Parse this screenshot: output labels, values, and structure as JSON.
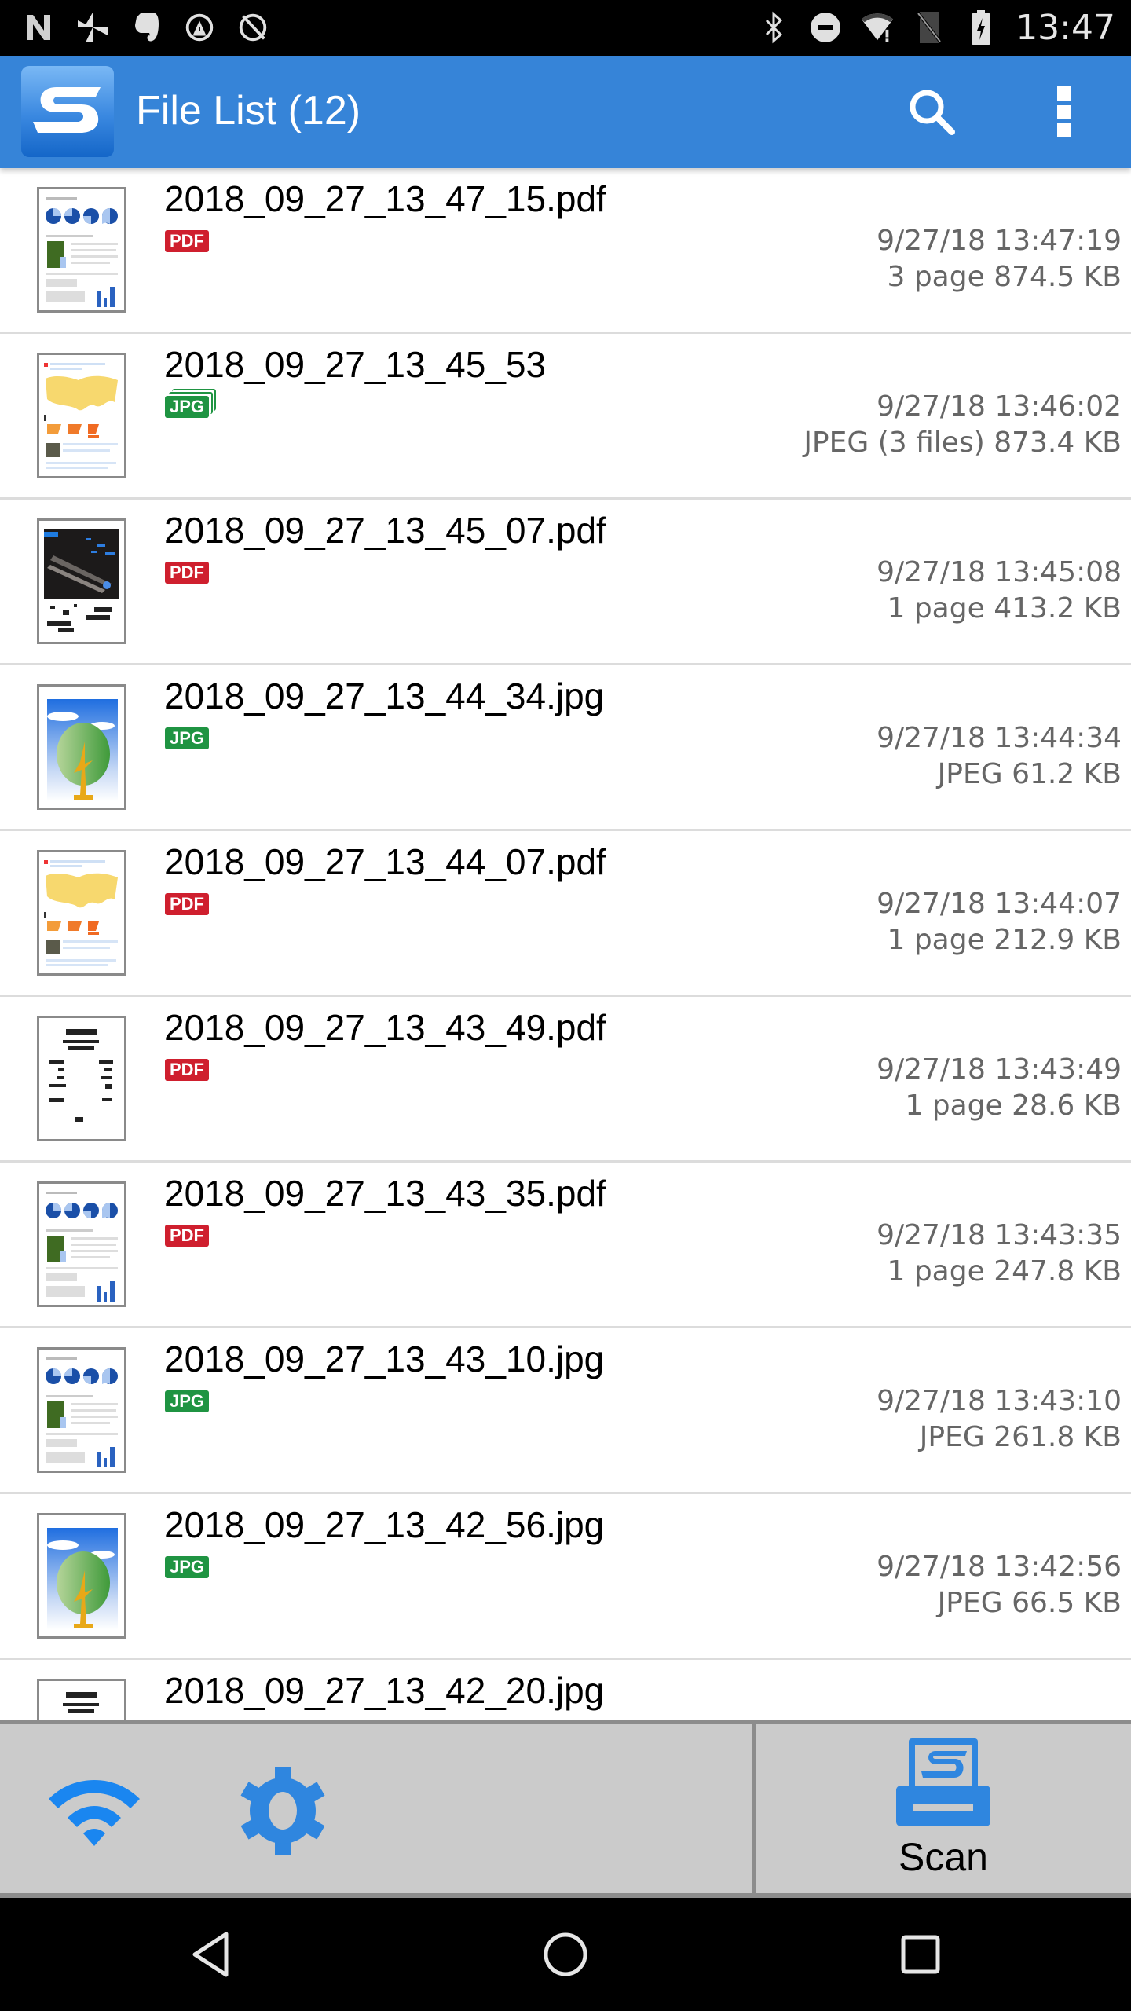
{
  "status_bar": {
    "time": "13:47",
    "left_icons": [
      "n-logo-icon",
      "pinwheel-icon",
      "evernote-icon",
      "sync-alert-icon",
      "sync-icon"
    ],
    "right_icons": [
      "bluetooth-icon",
      "do-not-disturb-icon",
      "wifi-alert-icon",
      "no-sim-icon",
      "battery-charging-icon"
    ]
  },
  "app_bar": {
    "title": "File List (12)",
    "logo_letter": "S",
    "search_icon": "search-icon",
    "menu_icon": "more-vert-icon"
  },
  "colors": {
    "app_bar": "#3684d8",
    "pdf_badge": "#cf1f2e",
    "jpg_badge": "#1f9442",
    "meta_text": "#666666",
    "toolbar_bg": "#cbcbcb",
    "icon_blue": "#2f86df"
  },
  "files": [
    {
      "name": "2018_09_27_13_47_15.pdf",
      "badge": "PDF",
      "date": "9/27/18 13:47:19",
      "size": "3 page 874.5 KB",
      "thumb": "doc-charts"
    },
    {
      "name": "2018_09_27_13_45_53",
      "badge": "JPG",
      "multi": true,
      "date": "9/27/18 13:46:02",
      "size": "JPEG (3 files) 873.4 KB",
      "thumb": "world-map"
    },
    {
      "name": "2018_09_27_13_45_07.pdf",
      "badge": "PDF",
      "date": "9/27/18 13:45:08",
      "size": "1 page 413.2 KB",
      "thumb": "dark-photo"
    },
    {
      "name": "2018_09_27_13_44_34.jpg",
      "badge": "JPG",
      "date": "9/27/18 13:44:34",
      "size": "JPEG 61.2 KB",
      "thumb": "tree"
    },
    {
      "name": "2018_09_27_13_44_07.pdf",
      "badge": "PDF",
      "date": "9/27/18 13:44:07",
      "size": "1 page 212.9 KB",
      "thumb": "world-map"
    },
    {
      "name": "2018_09_27_13_43_49.pdf",
      "badge": "PDF",
      "date": "9/27/18 13:43:49",
      "size": "1 page 28.6 KB",
      "thumb": "receipt"
    },
    {
      "name": "2018_09_27_13_43_35.pdf",
      "badge": "PDF",
      "date": "9/27/18 13:43:35",
      "size": "1 page 247.8 KB",
      "thumb": "doc-charts"
    },
    {
      "name": "2018_09_27_13_43_10.jpg",
      "badge": "JPG",
      "date": "9/27/18 13:43:10",
      "size": "JPEG 261.8 KB",
      "thumb": "doc-charts"
    },
    {
      "name": "2018_09_27_13_42_56.jpg",
      "badge": "JPG",
      "date": "9/27/18 13:42:56",
      "size": "JPEG 66.5 KB",
      "thumb": "tree"
    },
    {
      "name": "2018_09_27_13_42_20.jpg",
      "badge": "",
      "date": "",
      "size": "",
      "thumb": "receipt"
    }
  ],
  "bottom_bar": {
    "wifi_icon": "wifi-icon",
    "settings_icon": "settings-gear-icon",
    "scan_icon": "scanner-icon",
    "scan_label": "Scan"
  },
  "nav_bar": {
    "back": "back-icon",
    "home": "home-icon",
    "recents": "recents-icon"
  }
}
